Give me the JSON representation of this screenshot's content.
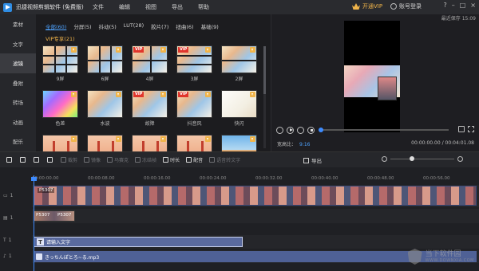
{
  "app": {
    "title": "迅捷视频剪辑软件 (免费版)",
    "menu": [
      "文件",
      "编辑",
      "视图",
      "导出",
      "帮助"
    ],
    "vip_label": "开通VIP",
    "login_label": "账号登录",
    "window_controls": [
      "?",
      "–",
      "□",
      "×"
    ]
  },
  "sidebar": {
    "items": [
      {
        "label": "素材",
        "active": false
      },
      {
        "label": "文字",
        "active": false
      },
      {
        "label": "滤镜",
        "active": true
      },
      {
        "label": "叠附",
        "active": false
      },
      {
        "label": "转场",
        "active": false
      },
      {
        "label": "动画",
        "active": false
      },
      {
        "label": "配乐",
        "active": false
      }
    ]
  },
  "media": {
    "tabs": [
      "全部(60)",
      "分屏(5)",
      "抖动(5)",
      "LUT(28)",
      "胶片(7)",
      "扭曲(6)",
      "基础(9)"
    ],
    "active_tab": 0,
    "section_title": "VIP专享(21)",
    "items": [
      {
        "label": "9屏",
        "style": "anime",
        "split": "3x3",
        "vip": false
      },
      {
        "label": "6屏",
        "style": "anime",
        "split": "3x2",
        "vip": false
      },
      {
        "label": "4屏",
        "style": "anime",
        "split": "2x2",
        "vip": true
      },
      {
        "label": "3屏",
        "style": "anime",
        "split": "3x1",
        "vip": true
      },
      {
        "label": "2屏",
        "style": "anime",
        "split": "2x1",
        "vip": false
      },
      {
        "label": "色差",
        "style": "color",
        "split": "none",
        "vip": false
      },
      {
        "label": "水波",
        "style": "anime",
        "split": "none",
        "vip": false
      },
      {
        "label": "故障",
        "style": "anime",
        "split": "none",
        "vip": true
      },
      {
        "label": "抖音风",
        "style": "anime",
        "split": "none",
        "vip": true
      },
      {
        "label": "快闪",
        "style": "white",
        "split": "none",
        "vip": false
      },
      {
        "label": "",
        "style": "bridge",
        "split": "none",
        "vip": false
      },
      {
        "label": "",
        "style": "bridge",
        "split": "none",
        "vip": false
      },
      {
        "label": "",
        "style": "bridge",
        "split": "none",
        "vip": false
      },
      {
        "label": "",
        "style": "bridge",
        "split": "none",
        "vip": false
      },
      {
        "label": "",
        "style": "sky",
        "split": "none",
        "vip": false
      }
    ]
  },
  "preview": {
    "last_saved": "最近保存 15:09",
    "aspect_label": "宽高比：",
    "aspect_value": "9:16",
    "timecode": "00:00:00.00 / 00:04:01.08",
    "progress": 0
  },
  "toolbar": {
    "tools": [
      {
        "label": "",
        "icon": "undo-icon",
        "enabled": true
      },
      {
        "label": "",
        "icon": "redo-icon",
        "enabled": true
      },
      {
        "label": "",
        "icon": "edit-icon",
        "enabled": true
      },
      {
        "label": "",
        "icon": "delete-icon",
        "enabled": true
      },
      {
        "label": "裁剪",
        "icon": "crop-icon",
        "enabled": false
      },
      {
        "label": "镜像",
        "icon": "mirror-icon",
        "enabled": false
      },
      {
        "label": "马赛克",
        "icon": "mosaic-icon",
        "enabled": false
      },
      {
        "label": "冻结帧",
        "icon": "freeze-icon",
        "enabled": false
      },
      {
        "label": "时长",
        "icon": "clock-icon",
        "enabled": true
      },
      {
        "label": "配音",
        "icon": "mic-icon",
        "enabled": true
      },
      {
        "label": "语音转文字",
        "icon": "speech-icon",
        "enabled": false
      }
    ],
    "export_label": "导出"
  },
  "timeline": {
    "ticks": [
      "00:00:00.00",
      "00:00:08.00",
      "00:00:16.00",
      "00:00:24.00",
      "00:00:32.00",
      "00:00:40.00",
      "00:00:48.00",
      "00:00:56.00"
    ],
    "video_clip_label": "P5307",
    "pip_labels": [
      "P5307",
      "P5307"
    ],
    "text_clip_label": "请输入文字",
    "audio_clip_label": "きっちんぽとろ~る.mp3",
    "track_numbers": [
      "1",
      "1",
      "1",
      "1"
    ]
  },
  "watermark": {
    "name": "当下软件园",
    "url": "WWW.DOWNXIA.COM"
  }
}
